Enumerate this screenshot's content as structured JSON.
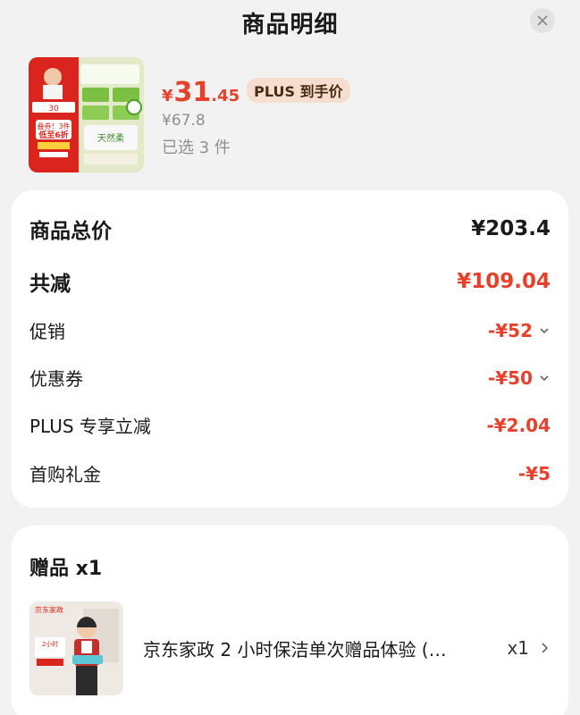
{
  "header": {
    "title": "商品明细"
  },
  "product": {
    "price_symbol": "¥",
    "price_int": "31",
    "price_dec": ".45",
    "plus_badge": "PLUS 到手价",
    "original_price": "¥67.8",
    "selected_count": "已选 3 件",
    "image_text": {
      "promo_top": "30",
      "promo_main": "叠券！3件",
      "promo_sub": "低至6折",
      "brand": "天然柔"
    }
  },
  "summary": {
    "rows": [
      {
        "label": "商品总价",
        "value": "¥203.4"
      },
      {
        "label": "共减",
        "value": "¥109.04"
      },
      {
        "label": "促销",
        "value": "-¥52"
      },
      {
        "label": "优惠券",
        "value": "-¥50"
      },
      {
        "label": "PLUS 专享立减",
        "value": "-¥2.04"
      },
      {
        "label": "首购礼金",
        "value": "-¥5"
      }
    ]
  },
  "gift": {
    "title": "赠品 x1",
    "item_name": "京东家政 2 小时保洁单次赠品体验 (…",
    "quantity": "x1",
    "image_text": {
      "brand": "京东家政",
      "badge": "2小时"
    }
  },
  "colors": {
    "accent_red": "#e8402a",
    "badge_bg": "#f5ddd0"
  }
}
